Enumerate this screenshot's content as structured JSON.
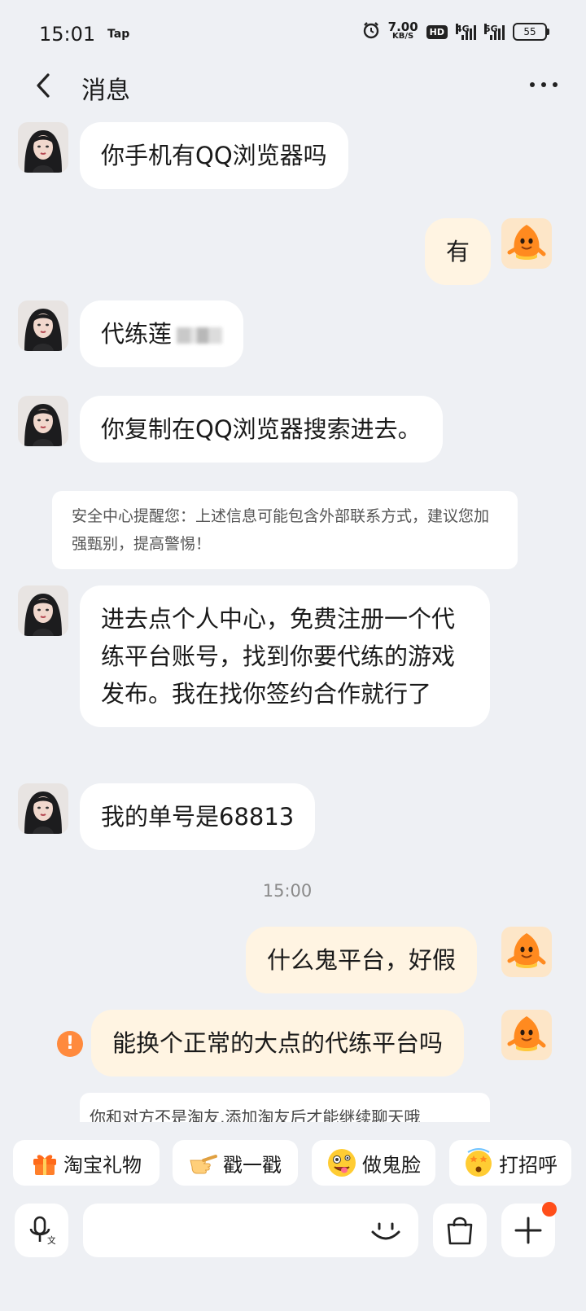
{
  "status_bar": {
    "time": "15:01",
    "app_tag": "Tap",
    "speed_value": "7.00",
    "speed_unit": "KB/S",
    "hd_badge": "HD",
    "network_1": "4G",
    "network_2": "5G",
    "battery": "55"
  },
  "header": {
    "title": "消息"
  },
  "messages": [
    {
      "side": "left",
      "text": "你手机有QQ浏览器吗"
    },
    {
      "side": "right",
      "text": "有"
    },
    {
      "side": "left",
      "text": "代练莲"
    },
    {
      "side": "left",
      "text": "你复制在QQ浏览器搜索进去。"
    },
    {
      "side": "left",
      "text": "进去点个人中心，免费注册一个代练平台账号，找到你要代练的游戏发布。我在找你签约合作就行了"
    },
    {
      "side": "left",
      "text": "我的单号是68813"
    },
    {
      "side": "right",
      "text": "什么鬼平台，好假"
    },
    {
      "side": "right",
      "text": "能换个正常的大点的代练平台吗",
      "failed": true
    }
  ],
  "security_notice": "安全中心提醒您：上述信息可能包含外部联系方式，建议您加强甄别，提高警惕！",
  "timestamp": "15:00",
  "warning_icon": "!",
  "bottom_notice": "你和对方不是淘友,添加淘友后才能继续聊天哦",
  "quick_replies": [
    {
      "label": "淘宝礼物",
      "icon": "gift-icon"
    },
    {
      "label": "戳一戳",
      "icon": "pointing-hand-icon"
    },
    {
      "label": "做鬼脸",
      "icon": "silly-face-icon"
    },
    {
      "label": "打招呼",
      "icon": "starstruck-face-icon"
    }
  ],
  "input": {
    "placeholder": ""
  },
  "colors": {
    "background": "#eef0f4",
    "my_bubble": "#fff4e2",
    "their_bubble": "#ffffff",
    "accent_orange": "#ff8a3d",
    "notification_dot": "#ff4e1a"
  }
}
